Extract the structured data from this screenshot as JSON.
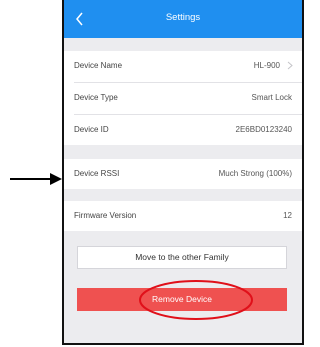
{
  "header": {
    "title": "Settings",
    "back_icon": "chevron-left-icon"
  },
  "rows": [
    {
      "label": "Device Name",
      "value": "HL-900",
      "chevron": true
    },
    {
      "label": "Device Type",
      "value": "Smart Lock"
    },
    {
      "label": "Device ID",
      "value": "2E6BD0123240"
    },
    {
      "label": "Device RSSI",
      "value": "Much Strong (100%)"
    },
    {
      "label": "Firmware Version",
      "value": "12"
    }
  ],
  "buttons": {
    "move_label": "Move to the other Family",
    "remove_label": "Remove Device"
  },
  "colors": {
    "navbar": "#1f8ff0",
    "remove_button": "#ef5150",
    "annotation_circle": "#e0101a",
    "annotation_arrow": "#000000"
  }
}
